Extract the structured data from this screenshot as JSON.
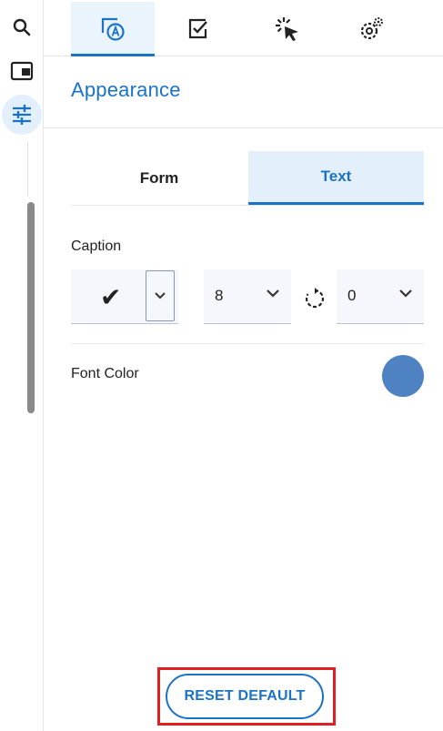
{
  "rail": {
    "items": [
      {
        "icon": "search-icon"
      },
      {
        "icon": "panel-icon"
      },
      {
        "icon": "sliders-icon",
        "active": true
      }
    ]
  },
  "top_tabs": [
    {
      "icon": "appearance-icon",
      "active": true
    },
    {
      "icon": "checkbox-icon"
    },
    {
      "icon": "click-icon"
    },
    {
      "icon": "settings-icon"
    }
  ],
  "section": {
    "title": "Appearance"
  },
  "sub_tabs": {
    "form": "Form",
    "text": "Text",
    "active": "Text"
  },
  "caption": {
    "label": "Caption",
    "check_glyph": "✔",
    "size_value": "8",
    "rotation_value": "0"
  },
  "font_color": {
    "label": "Font Color",
    "color": "#4f82c2"
  },
  "reset": {
    "label": "RESET DEFAULT"
  },
  "colors": {
    "accent": "#1a73c9",
    "highlight": "#e02020"
  }
}
